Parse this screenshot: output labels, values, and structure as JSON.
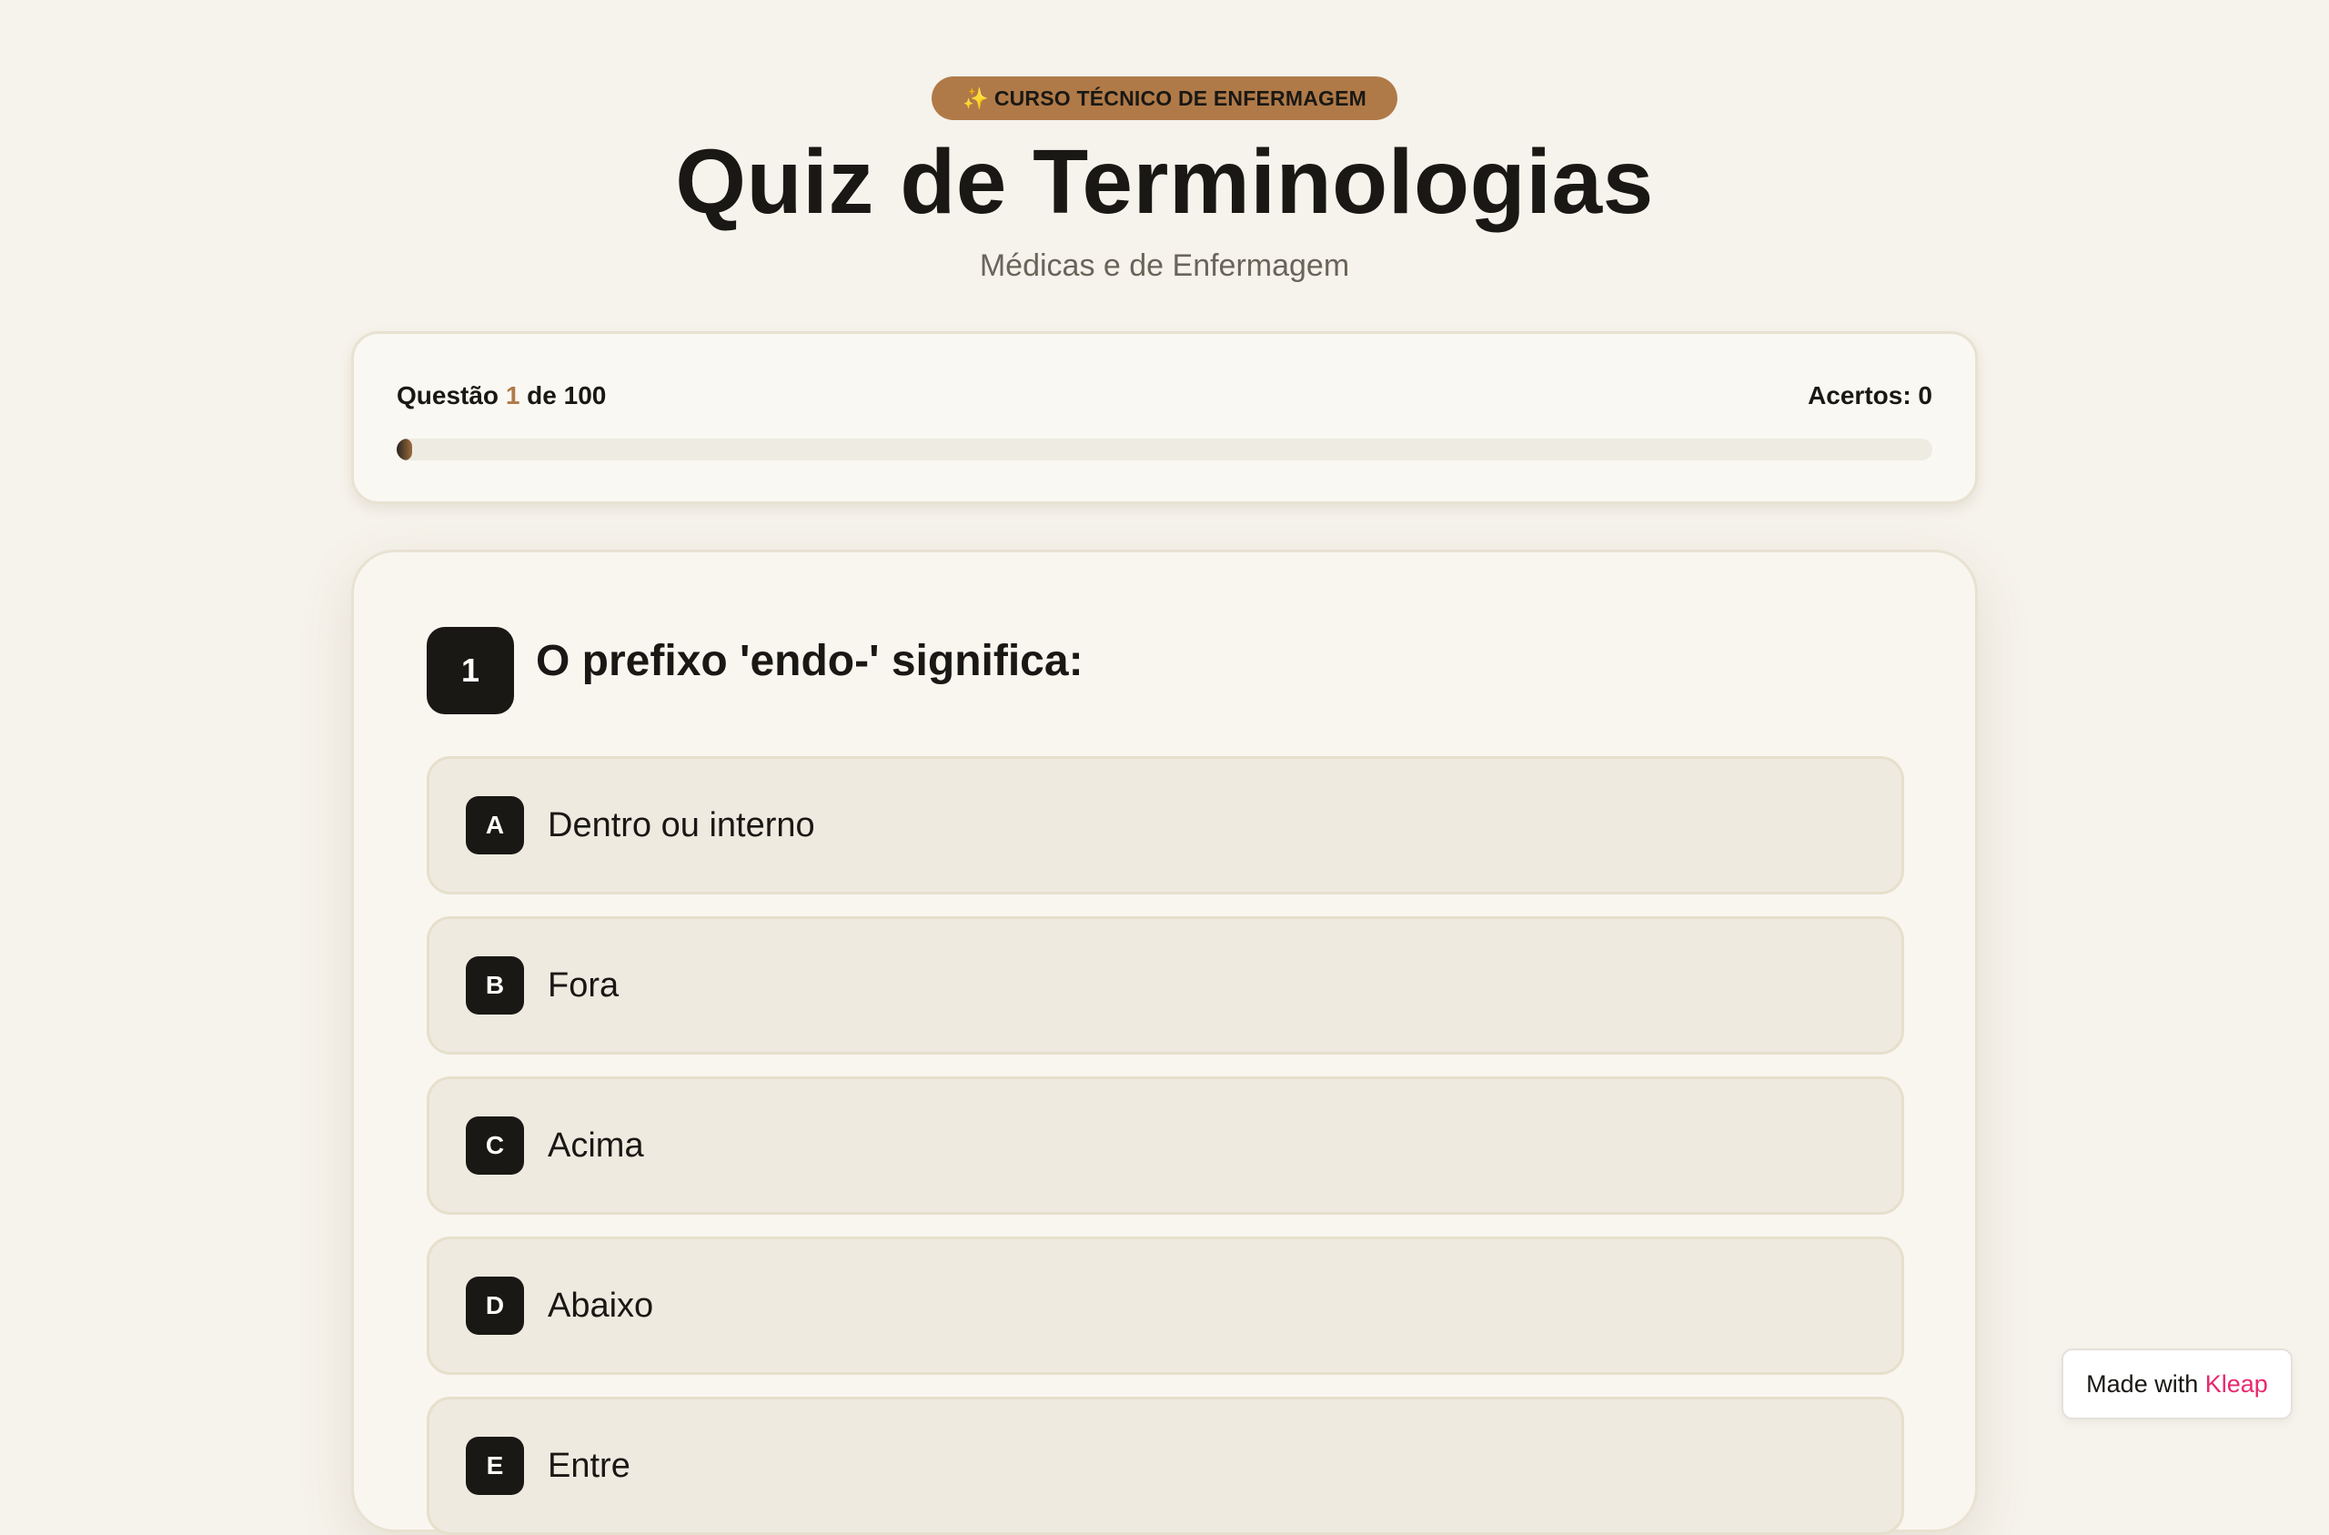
{
  "header": {
    "badge_icon": "sparkles-icon",
    "badge_label": "CURSO TÉCNICO DE ENFERMAGEM",
    "title": "Quiz de Terminologias",
    "subtitle": "Médicas e de Enfermagem"
  },
  "progress": {
    "prefix": "Questão",
    "current": "1",
    "middle": "de",
    "total": "100",
    "score_label": "Acertos: 0",
    "fraction": 0.01
  },
  "question": {
    "number": "1",
    "text": "O prefixo 'endo-' significa:",
    "options": [
      {
        "letter": "A",
        "text": "Dentro ou interno"
      },
      {
        "letter": "B",
        "text": "Fora"
      },
      {
        "letter": "C",
        "text": "Acima"
      },
      {
        "letter": "D",
        "text": "Abaixo"
      },
      {
        "letter": "E",
        "text": "Entre"
      }
    ]
  },
  "footer": {
    "made_with_prefix": "Made with",
    "made_with_brand": "Kleap"
  },
  "colors": {
    "accent": "#b07a48",
    "background": "#f6f3ec",
    "dark": "#1a1814",
    "brand": "#e8286e"
  }
}
